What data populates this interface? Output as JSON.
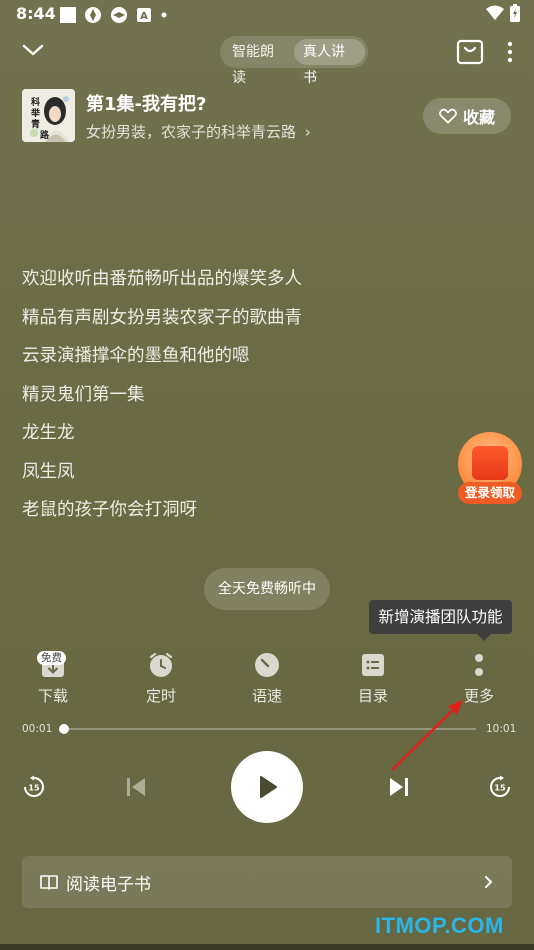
{
  "status_bar": {
    "time": "8:44"
  },
  "top_bar": {
    "mode_tabs": [
      {
        "label": "智能朗读",
        "active": false
      },
      {
        "label": "真人讲书",
        "active": true
      }
    ]
  },
  "book": {
    "episode_title": "第1集-我有把?",
    "subtitle": "女扮男装，农家子的科举青云路",
    "favorite_label": "收藏",
    "cover_text": "科举青云路"
  },
  "lyrics": [
    "欢迎收听由番茄畅听出品的爆笑多人",
    "精品有声剧女扮男装农家子的歌曲青",
    "云录演播撑伞的墨鱼和他的嗯",
    "精灵鬼们第一集",
    "龙生龙",
    "凤生凤",
    "老鼠的孩子你会打洞呀"
  ],
  "promo": {
    "label": "登录领取"
  },
  "free_pill": "全天免费畅听中",
  "tooltip": "新增演播团队功能",
  "functions": [
    {
      "label": "下载",
      "badge": "免费",
      "icon": "download-icon"
    },
    {
      "label": "定时",
      "icon": "alarm-clock-icon"
    },
    {
      "label": "语速",
      "icon": "speed-gauge-icon"
    },
    {
      "label": "目录",
      "icon": "catalog-icon"
    },
    {
      "label": "更多",
      "icon": "more-vertical-icon"
    }
  ],
  "progress": {
    "current": "00:01",
    "total": "10:01",
    "fraction": 0.0
  },
  "controls": {
    "rewind_seconds": "15",
    "forward_seconds": "15"
  },
  "ebook": {
    "label": "阅读电子书"
  },
  "watermark": "ITMOP.COM",
  "colors": {
    "background": "#6b6b44",
    "accent_orange": "#ef5b24",
    "annotation_red": "#e0201b",
    "watermark": "#29b6e8"
  }
}
